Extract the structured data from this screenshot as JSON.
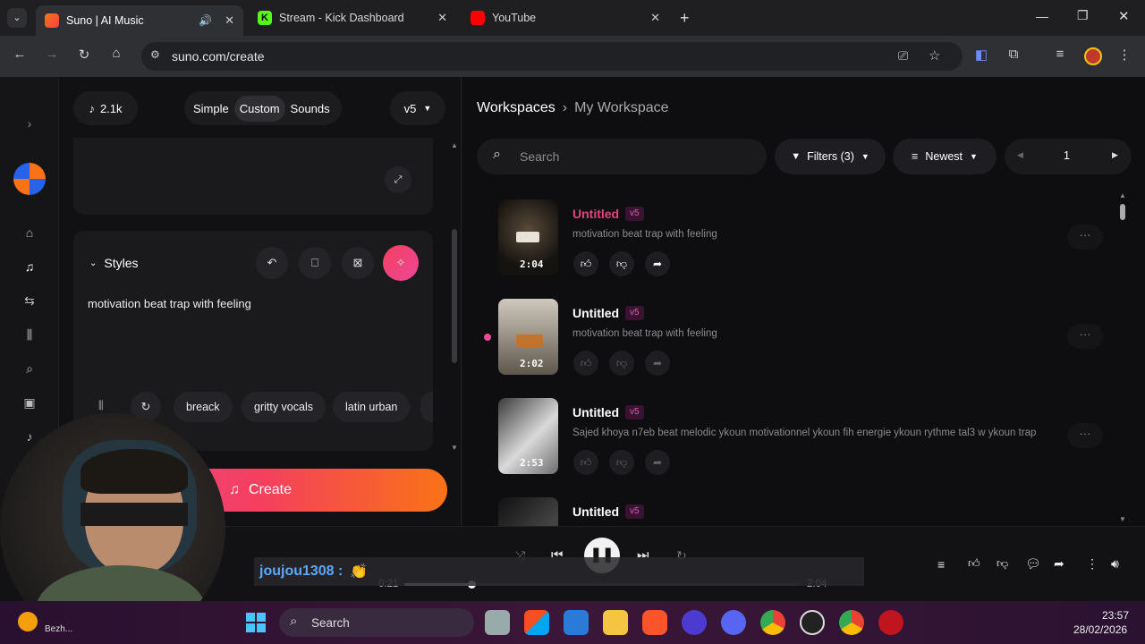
{
  "browser": {
    "tabs": [
      {
        "title": "Suno | AI Music",
        "active": true
      },
      {
        "title": "Stream - Kick Dashboard",
        "active": false
      },
      {
        "title": "YouTube",
        "active": false
      }
    ],
    "url": "suno.com/create"
  },
  "create": {
    "credits": "2.1k",
    "modes": [
      "Simple",
      "Custom",
      "Sounds"
    ],
    "active_mode": "Custom",
    "version": "v5",
    "styles_label": "Styles",
    "styles_text": "motivation beat trap with feeling",
    "tags": [
      "breack",
      "gritty vocals",
      "latin urban"
    ],
    "create_button": "Create"
  },
  "workspace": {
    "breadcrumb_root": "Workspaces",
    "breadcrumb_current": "My Workspace",
    "search_placeholder": "Search",
    "filters": "Filters (3)",
    "sort": "Newest",
    "page": "1",
    "songs": [
      {
        "title": "Untitled",
        "version": "v5",
        "description": "motivation beat trap with feeling",
        "duration": "2:04",
        "playing": true
      },
      {
        "title": "Untitled",
        "version": "v5",
        "description": "motivation beat trap with feeling",
        "duration": "2:02",
        "playing": false
      },
      {
        "title": "Untitled",
        "version": "v5",
        "description": "Sajed khoya n7eb beat melodic ykoun motivationnel ykoun fih energie ykoun rythme tal3 w ykoun trap",
        "duration": "2:53",
        "playing": false
      },
      {
        "title": "Untitled",
        "version": "v5",
        "description": "",
        "duration": "",
        "playing": false
      }
    ]
  },
  "player": {
    "elapsed": "0:21",
    "total": "2:04",
    "progress": 0.17
  },
  "overlay": {
    "chat_user": "joujou1308 :",
    "chat_emoji": "👏"
  },
  "taskbar": {
    "search": "Search",
    "time": "23:57",
    "date": "28/02/2026",
    "weather_label": "Bezh..."
  },
  "colors": {
    "accent": "#e0467c",
    "create_gradient": [
      "#e94057",
      "#f27121"
    ],
    "brand_pink": "#ec4899"
  }
}
